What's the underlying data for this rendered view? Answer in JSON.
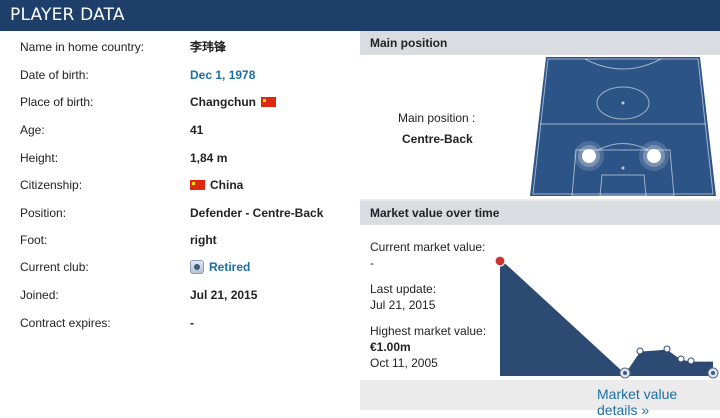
{
  "header": {
    "title": "PLAYER DATA"
  },
  "player_info": [
    {
      "label": "Name in home country:",
      "value": "李玮锋"
    },
    {
      "label": "Date of birth:",
      "value": "Dec 1, 1978",
      "link": true
    },
    {
      "label": "Place of birth:",
      "value": "Changchun",
      "flag_after": "china-flag-icon"
    },
    {
      "label": "Age:",
      "value": "41"
    },
    {
      "label": "Height:",
      "value": "1,84 m"
    },
    {
      "label": "Citizenship:",
      "value": "China",
      "flag_before": "china-flag-icon"
    },
    {
      "label": "Position:",
      "value": "Defender - Centre-Back"
    },
    {
      "label": "Foot:",
      "value": "right"
    },
    {
      "label": "Current club:",
      "value": "Retired",
      "link": true,
      "icon": "retired-club-icon"
    },
    {
      "label": "Joined:",
      "value": "Jul 21, 2015"
    },
    {
      "label": "Contract expires:",
      "value": "-"
    }
  ],
  "main_position": {
    "heading": "Main position",
    "label": "Main position :",
    "value": "Centre-Back"
  },
  "market_value": {
    "heading": "Market value over time",
    "current_label": "Current market value:",
    "current_value": "-",
    "update_label": "Last update:",
    "update_value": "Jul 21, 2015",
    "highest_label": "Highest market value:",
    "highest_value": "€1.00m",
    "highest_date": "Oct 11, 2005",
    "details_link": "Market value details »"
  },
  "colors": {
    "header_bg": "#1d3f6a",
    "pitch": "#2d5486",
    "link": "#1a6fa3",
    "chart_fill": "#2d4a72"
  }
}
